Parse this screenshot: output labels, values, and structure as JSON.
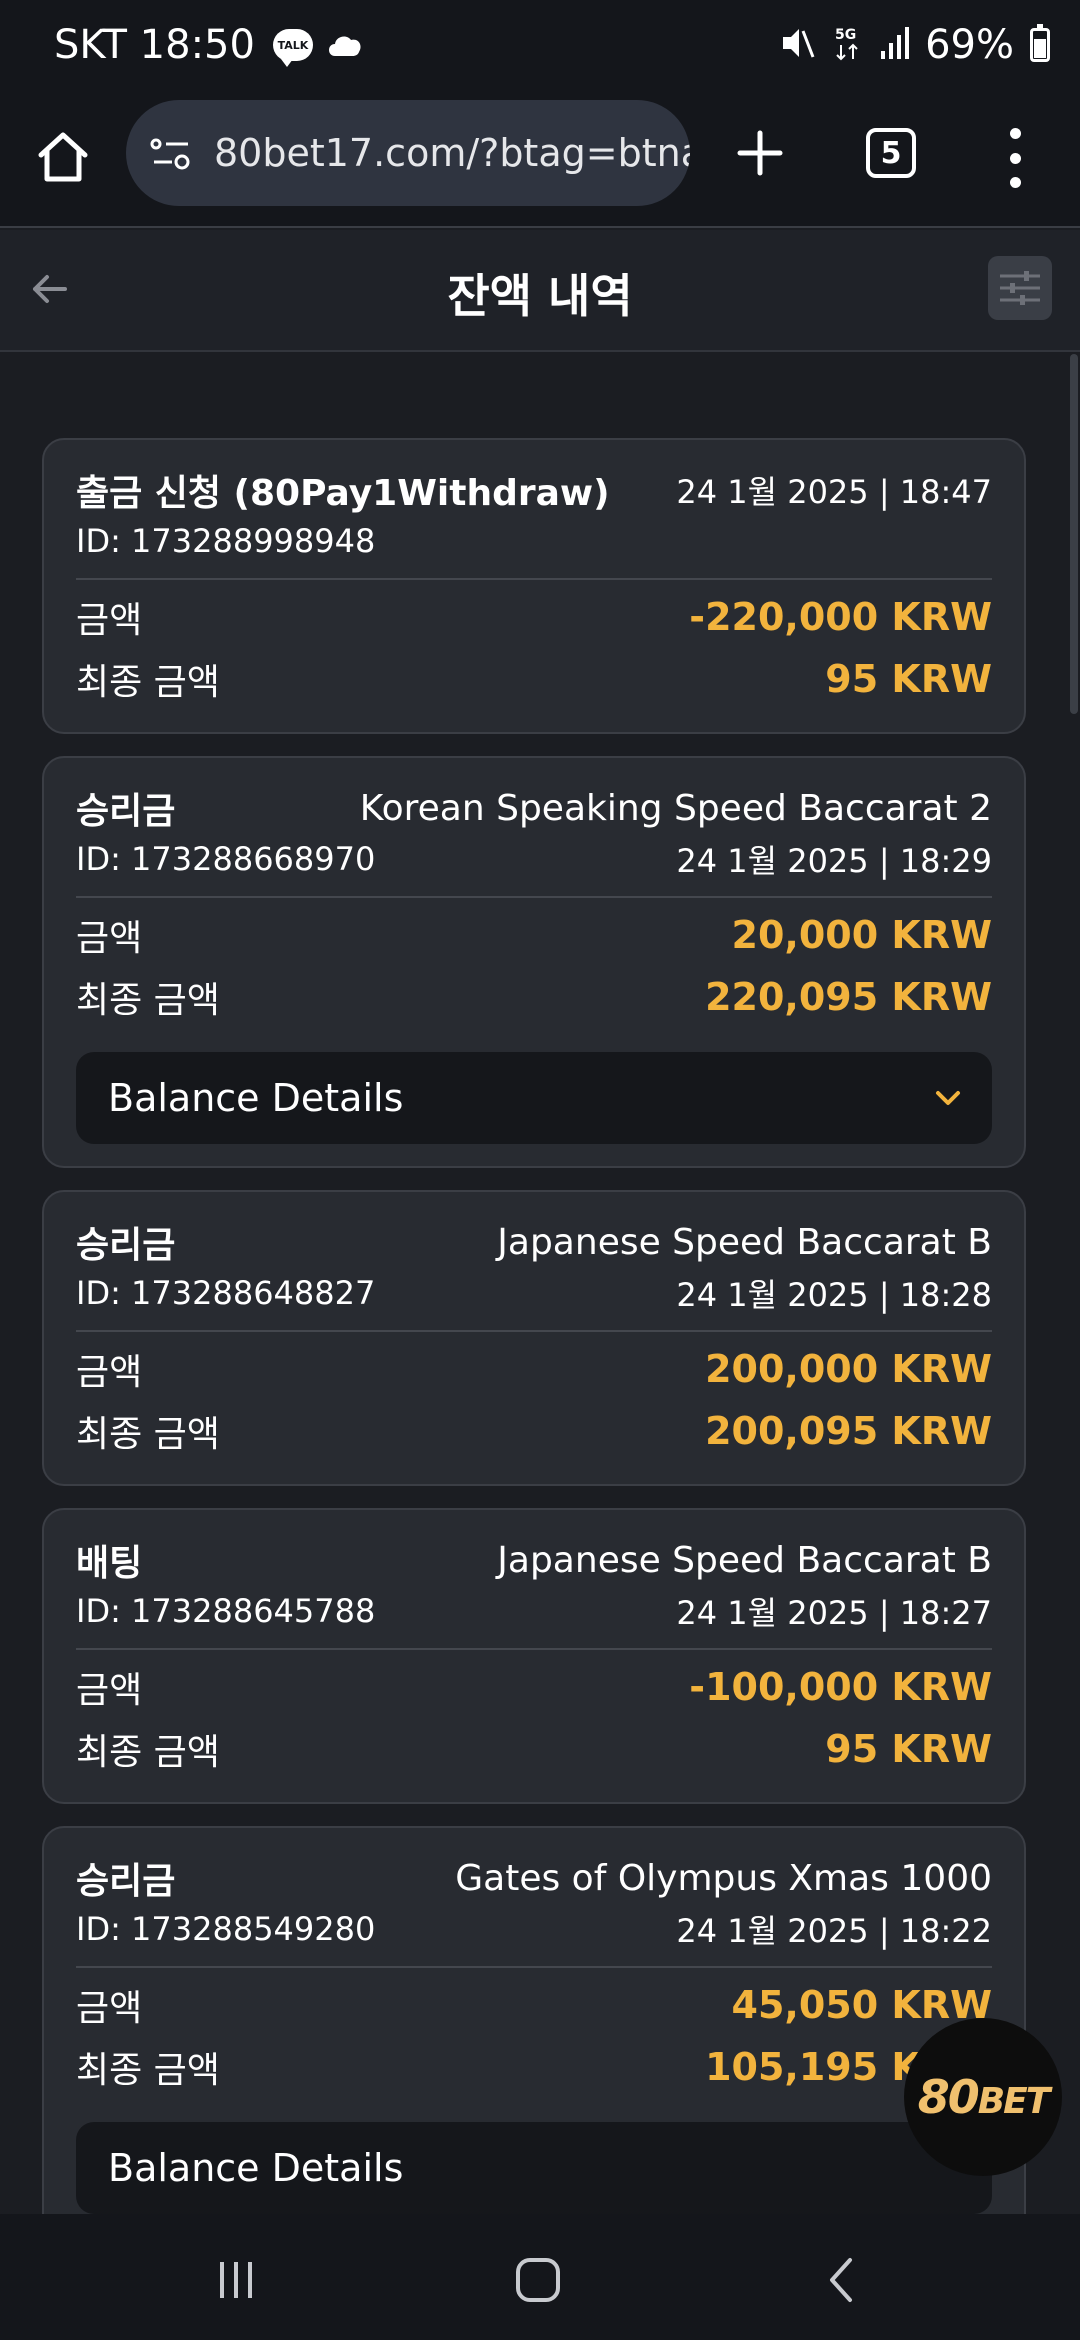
{
  "status_bar": {
    "carrier_time": "SKT 18:50",
    "talk_badge": "TALK",
    "network": "5G",
    "battery": "69%"
  },
  "browser": {
    "url": "80bet17.com/?btag=btna",
    "tab_count": "5"
  },
  "header": {
    "title": "잔액 내역"
  },
  "transactions": [
    {
      "type": "출금 신청 (80Pay1Withdraw)",
      "game": "",
      "id": "ID: 173288998948",
      "datetime": "24 1월 2025 | 18:47",
      "amount_label": "금액",
      "amount": "-220,000 KRW",
      "final_label": "최종 금액",
      "final": "95 KRW",
      "details": ""
    },
    {
      "type": "승리금",
      "game": "Korean Speaking Speed Baccarat 2",
      "id": "ID: 173288668970",
      "datetime": "24 1월 2025 | 18:29",
      "amount_label": "금액",
      "amount": "20,000 KRW",
      "final_label": "최종 금액",
      "final": "220,095 KRW",
      "details": "Balance Details"
    },
    {
      "type": "승리금",
      "game": "Japanese Speed Baccarat B",
      "id": "ID: 173288648827",
      "datetime": "24 1월 2025 | 18:28",
      "amount_label": "금액",
      "amount": "200,000 KRW",
      "final_label": "최종 금액",
      "final": "200,095 KRW",
      "details": ""
    },
    {
      "type": "배팅",
      "game": "Japanese Speed Baccarat B",
      "id": "ID: 173288645788",
      "datetime": "24 1월 2025 | 18:27",
      "amount_label": "금액",
      "amount": "-100,000 KRW",
      "final_label": "최종 금액",
      "final": "95 KRW",
      "details": ""
    },
    {
      "type": "승리금",
      "game": "Gates of Olympus Xmas 1000",
      "id": "ID: 173288549280",
      "datetime": "24 1월 2025 | 18:22",
      "amount_label": "금액",
      "amount": "45,050 KRW",
      "final_label": "최종 금액",
      "final": "105,195 KRW",
      "details": "Balance Details"
    }
  ],
  "logo": {
    "text_a": "80",
    "text_b": "BET"
  },
  "colors": {
    "accent": "#f2b33d",
    "background": "#1b1d22",
    "card": "#282b31"
  },
  "icons": [
    "home-icon",
    "tune-icon",
    "plus-icon",
    "tabs-icon",
    "more-icon",
    "back-arrow-icon",
    "filter-icon",
    "chevron-down-icon",
    "recents-icon",
    "home-nav-icon",
    "back-nav-icon"
  ]
}
